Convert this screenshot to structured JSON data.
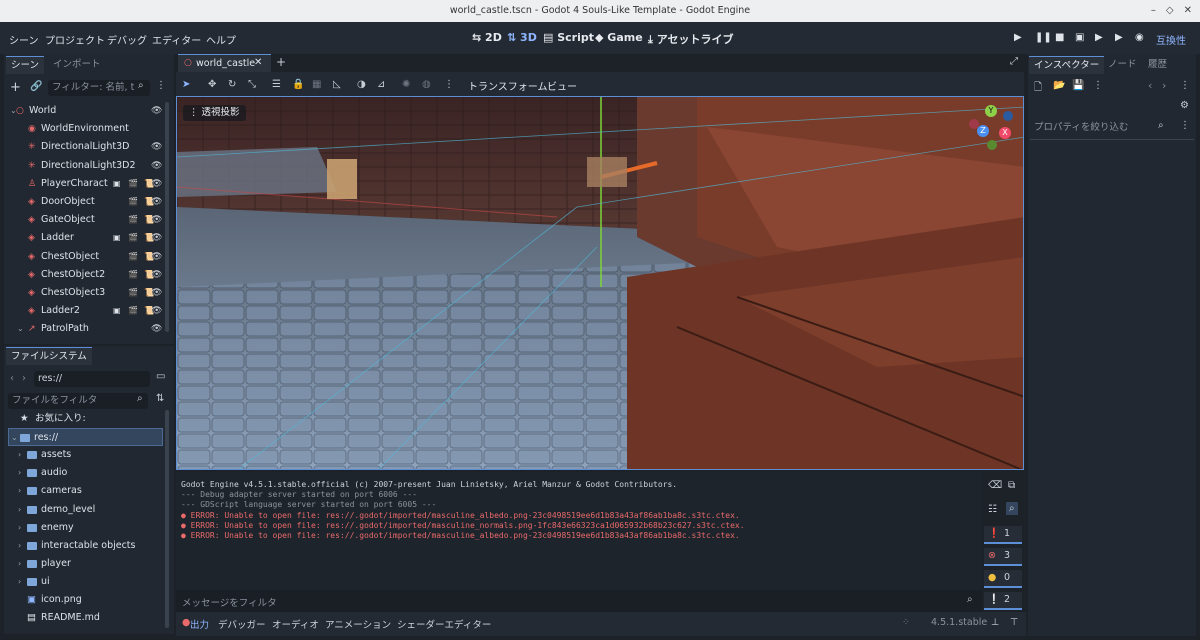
{
  "window": {
    "title": "world_castle.tscn - Godot 4 Souls-Like Template - Godot Engine",
    "controls": [
      "–",
      "◇",
      "✕"
    ]
  },
  "menu": [
    "シーン",
    "プロジェクト",
    "デバッグ",
    "エディター",
    "ヘルプ"
  ],
  "workspaces": [
    "2D",
    "3D",
    "Script",
    "Game",
    "アセットライブ"
  ],
  "active_workspace": "3D",
  "renderer": "互換性",
  "scene_panel": {
    "tabs": [
      "シーン",
      "インポート"
    ],
    "filter_placeholder": "フィルター: 名前, t",
    "nodes": [
      {
        "name": "World",
        "icon": "○",
        "color": "#e86a6a",
        "arrow": "⌄",
        "badges": [],
        "eye": true
      },
      {
        "name": "WorldEnvironment",
        "icon": "◉",
        "color": "#e86a6a",
        "arrow": "",
        "badges": [],
        "eye": false
      },
      {
        "name": "DirectionalLight3D",
        "icon": "✳",
        "color": "#e86a6a",
        "arrow": "",
        "badges": [],
        "eye": true
      },
      {
        "name": "DirectionalLight3D2",
        "icon": "✳",
        "color": "#e86a6a",
        "arrow": "",
        "badges": [],
        "eye": true
      },
      {
        "name": "PlayerCharact",
        "icon": "♙",
        "color": "#e86a6a",
        "arrow": "",
        "badges": [
          "▣",
          "🎬",
          "📜"
        ],
        "eye": true
      },
      {
        "name": "DoorObject",
        "icon": "◈",
        "color": "#e86a6a",
        "arrow": "",
        "badges": [
          "🎬",
          "📜"
        ],
        "eye": true
      },
      {
        "name": "GateObject",
        "icon": "◈",
        "color": "#e86a6a",
        "arrow": "",
        "badges": [
          "🎬",
          "📜"
        ],
        "eye": true
      },
      {
        "name": "Ladder",
        "icon": "◈",
        "color": "#e86a6a",
        "arrow": "",
        "badges": [
          "▣",
          "🎬",
          "📜"
        ],
        "eye": true
      },
      {
        "name": "ChestObject",
        "icon": "◈",
        "color": "#e86a6a",
        "arrow": "",
        "badges": [
          "🎬",
          "📜"
        ],
        "eye": true
      },
      {
        "name": "ChestObject2",
        "icon": "◈",
        "color": "#e86a6a",
        "arrow": "",
        "badges": [
          "🎬",
          "📜"
        ],
        "eye": true
      },
      {
        "name": "ChestObject3",
        "icon": "◈",
        "color": "#e86a6a",
        "arrow": "",
        "badges": [
          "🎬",
          "📜"
        ],
        "eye": true
      },
      {
        "name": "Ladder2",
        "icon": "◈",
        "color": "#e86a6a",
        "arrow": "",
        "badges": [
          "▣",
          "🎬",
          "📜"
        ],
        "eye": true
      },
      {
        "name": "PatrolPath",
        "icon": "↗",
        "color": "#e86a6a",
        "arrow": "⌄",
        "badges": [],
        "eye": true
      }
    ]
  },
  "filesystem": {
    "tab": "ファイルシステム",
    "path": "res://",
    "filter_placeholder": "ファイルをフィルタ",
    "favorites_label": "お気に入り:",
    "root": "res://",
    "folders": [
      "assets",
      "audio",
      "cameras",
      "demo_level",
      "enemy",
      "interactable objects",
      "player",
      "ui"
    ],
    "files": [
      "icon.png",
      "README.md"
    ]
  },
  "editor_tabs": {
    "open_scene": "world_castle",
    "add_icon": "+"
  },
  "viewport": {
    "toolbar_menus": [
      "トランスフォーム",
      "ビュー"
    ],
    "perspective_label": "透視投影",
    "gizmo_axes": [
      "Y",
      "Z",
      "X"
    ]
  },
  "output": {
    "lines": [
      {
        "text": "Godot Engine v4.5.1.stable.official (c) 2007-present Juan Linietsky, Ariel Manzur & Godot Contributors.",
        "kind": "info"
      },
      {
        "text": "--- Debug adapter server started on port 6006 ---",
        "kind": "dim"
      },
      {
        "text": "--- GDScript language server started on port 6005 ---",
        "kind": "dim"
      },
      {
        "text": "● ERROR: Unable to open file: res://.godot/imported/masculine_albedo.png-23c0498519ee6d1b83a43af86ab1ba8c.s3tc.ctex.",
        "kind": "error"
      },
      {
        "text": "● ERROR: Unable to open file: res://.godot/imported/masculine_normals.png-1fc843e66323ca1d065932b68b23c627.s3tc.ctex.",
        "kind": "error"
      },
      {
        "text": "● ERROR: Unable to open file: res://.godot/imported/masculine_albedo.png-23c0498519ee6d1b83a43af86ab1ba8c.s3tc.ctex.",
        "kind": "error"
      }
    ],
    "filter_placeholder": "メッセージをフィルタ",
    "counts": {
      "messages": "1",
      "errors": "3",
      "warnings": "0",
      "editor": "2"
    }
  },
  "bottom_tabs": [
    "出力",
    "デバッガー",
    "オーディオ",
    "アニメーション",
    "シェーダーエディター"
  ],
  "version": "4.5.1.stable",
  "inspector": {
    "tabs": [
      "インスペクター",
      "ノード",
      "履歴"
    ],
    "filter_placeholder": "プロパティを絞り込む"
  },
  "colors": {
    "accent": "#5c8fd6",
    "error": "#e86a6a",
    "panel": "#222831",
    "background": "#1d2229"
  }
}
